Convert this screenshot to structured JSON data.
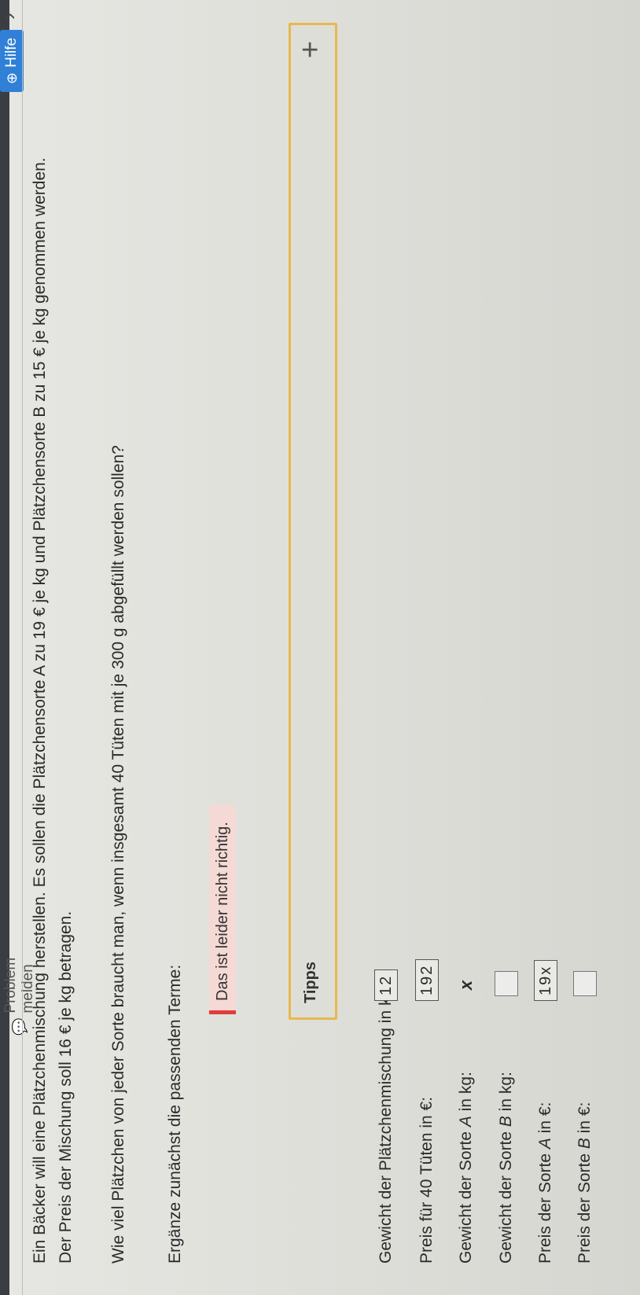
{
  "header": {
    "report_label": "Problem melden",
    "help_label": "Hilfe"
  },
  "task": {
    "line1": "Ein Bäcker will eine Plätzchenmischung herstellen. Es sollen die Plätzchensorte A zu 19 € je kg und Plätzchensorte B zu 15 € je kg genommen werden.",
    "line2": "Der Preis der Mischung soll 16 € je kg betragen.",
    "question": "Wie viel Plätzchen von jeder Sorte braucht man, wenn insgesamt 40 Tüten mit je 300 g abgefüllt werden sollen?",
    "instruction": "Ergänze zunächst die passenden Terme:"
  },
  "feedback": {
    "error_text": "Das ist leider nicht richtig.",
    "error_color": "#e13c3c"
  },
  "tips": {
    "label": "Tipps",
    "expand_symbol": "+"
  },
  "rows": [
    {
      "label": "Gewicht der Plätzchenmischung in kg:",
      "value": "12"
    },
    {
      "label": "Preis für 40 Tüten in €:",
      "value": "192"
    },
    {
      "label": "Gewicht der Sorte A in kg:",
      "value": "x"
    },
    {
      "label": "Gewicht der Sorte B in kg:",
      "value": ""
    },
    {
      "label": "Preis der Sorte A in €:",
      "value": "19x"
    },
    {
      "label": "Preis der Sorte B in €:",
      "value": ""
    }
  ]
}
